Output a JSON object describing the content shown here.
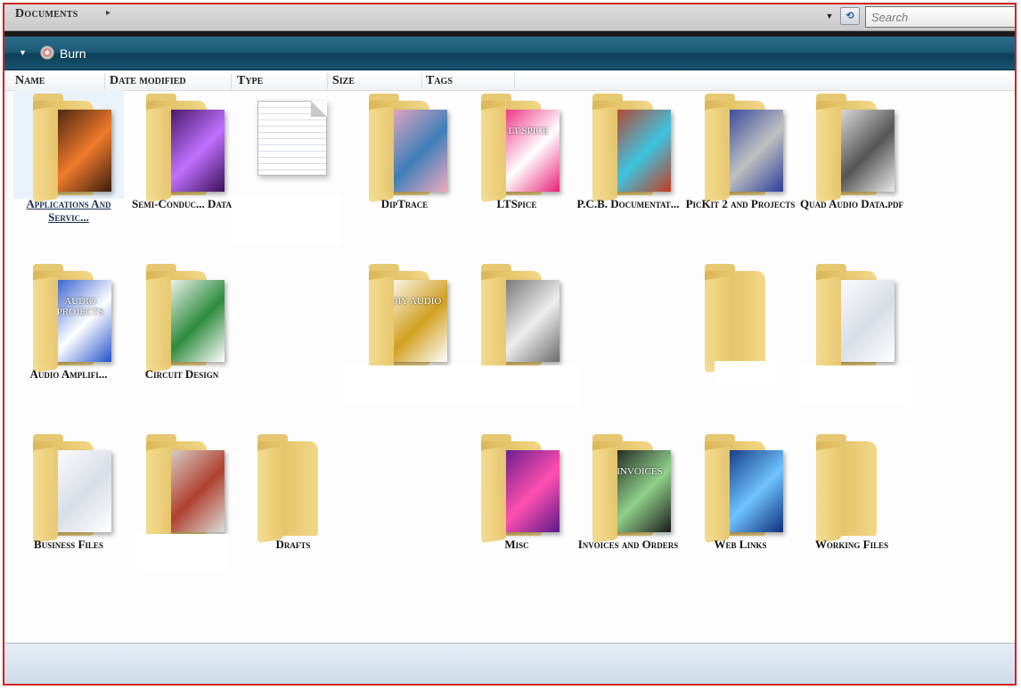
{
  "breadcrumb": {
    "label": "Documents",
    "arrow": "▸"
  },
  "search": {
    "placeholder": "Search"
  },
  "toolbar": {
    "collapse": "▼",
    "burn_label": "Burn",
    "refresh": "⟲"
  },
  "columns": [
    "Name",
    "Date modified",
    "Type",
    "Size",
    "Tags"
  ],
  "items": [
    {
      "label": "Applications And Servic...",
      "icon": "folder-apps-icon",
      "paper": "#3a1d0e",
      "accent": "#f07a2a",
      "selected": true
    },
    {
      "label": "Semi-Conduc... Data",
      "icon": "folder-semiconductor-icon",
      "paper": "#3a0f5a",
      "accent": "#c070ff"
    },
    {
      "label": "",
      "icon": "text-document-icon"
    },
    {
      "label": "DipTrace",
      "icon": "folder-diptrace-icon",
      "paper": "#f2a9c0",
      "accent": "#3d7fb9"
    },
    {
      "label": "LTSpice",
      "icon": "folder-ltspice-icon",
      "paper": "#ea1f77",
      "accent": "#ffffff",
      "paper_text": "LT SPICE"
    },
    {
      "label": "P.C.B. Documentat...",
      "icon": "folder-pcb-icon",
      "paper": "#c23b1f",
      "accent": "#3dc4e0"
    },
    {
      "label": "PicKit 2 and Projects",
      "icon": "folder-pickit-icon",
      "paper": "#2a3f9a",
      "accent": "#c0c0c0"
    },
    {
      "label": "Quad Audio Data.pdf",
      "icon": "folder-quad-audio-icon",
      "paper": "#e9e9e9",
      "accent": "#555555"
    },
    {
      "label": "Audio Amplifi...",
      "icon": "folder-audio-projects-icon",
      "paper": "#2452c9",
      "accent": "#ffffff",
      "paper_text": "AUDIO PROJECTS"
    },
    {
      "label": "Circuit Design",
      "icon": "folder-circuit-design-icon",
      "paper": "#ffffff",
      "accent": "#2e8b3e"
    },
    {
      "label": "",
      "icon": "folder-diy-audio-icon",
      "paper": "#ffffff",
      "accent": "#d0a020",
      "paper_text": "DIY AUDIO"
    },
    {
      "label": "",
      "icon": "folder-test-pattern-icon",
      "paper": "#6a6a6a",
      "accent": "#eeeeee"
    },
    {
      "label": "",
      "icon": "folder-empty-icon"
    },
    {
      "label": "",
      "icon": "folder-document-icon",
      "paper": "#ffffff",
      "accent": "#d9dde6"
    },
    {
      "label": "Business Files",
      "icon": "folder-business-icon",
      "paper": "#ffffff",
      "accent": "#d9dde6"
    },
    {
      "label": "",
      "icon": "folder-books-icon",
      "paper": "#d9ded6",
      "accent": "#b04030"
    },
    {
      "label": "Drafts",
      "icon": "folder-drafts-icon"
    },
    {
      "label": "Misc",
      "icon": "folder-misc-icon",
      "paper": "#5a1a8a",
      "accent": "#ff4fb0"
    },
    {
      "label": "Invoices and Orders",
      "icon": "folder-invoices-icon",
      "paper": "#1a1a1a",
      "accent": "#8fd08a",
      "paper_text": "INVOICES"
    },
    {
      "label": "Web Links",
      "icon": "folder-web-links-icon",
      "paper": "#0d2f7a",
      "accent": "#6fc3ff"
    },
    {
      "label": "Working Files",
      "icon": "folder-working-files-icon"
    }
  ]
}
